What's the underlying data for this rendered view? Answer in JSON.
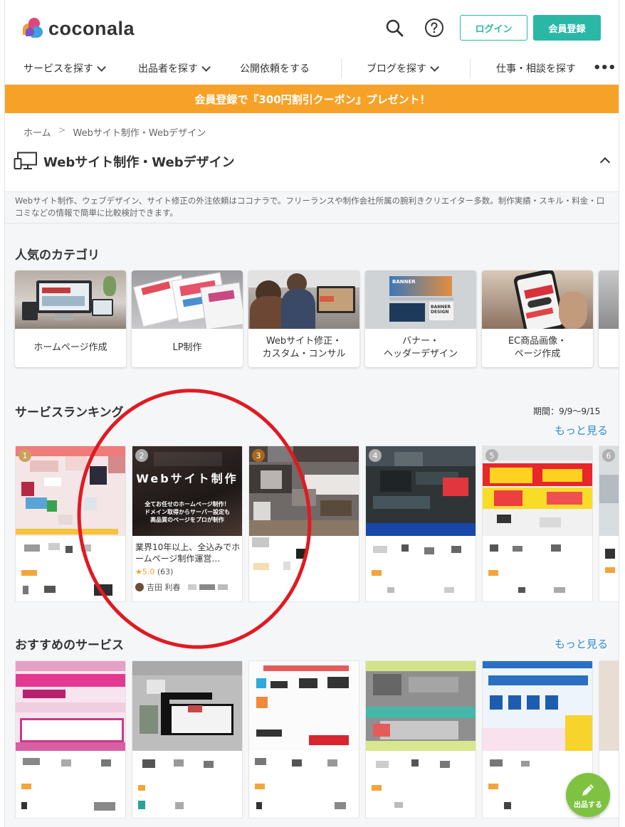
{
  "header": {
    "logo_text": "coconala",
    "login_label": "ログイン",
    "signup_label": "会員登録"
  },
  "nav": {
    "items": [
      {
        "label": "サービスを探す",
        "dropdown": true
      },
      {
        "label": "出品者を探す",
        "dropdown": true
      },
      {
        "label": "公開依頼をする",
        "dropdown": false
      },
      {
        "label": "ブログを探す",
        "dropdown": true
      },
      {
        "label": "仕事・相談を探す",
        "dropdown": false
      }
    ],
    "more": "•••"
  },
  "promo": {
    "text": "会員登録で『300円割引クーポン』プレゼント！"
  },
  "breadcrumb": {
    "home": "ホーム",
    "separator": ">",
    "current": "Webサイト制作・Webデザイン"
  },
  "category": {
    "title": "Webサイト制作・Webデザイン",
    "description": "Webサイト制作、ウェブデザイン、サイト修正の外注依頼はココナラで。フリーランスや制作会社所属の腕利きクリエイター多数。制作実績・スキル・料金・口コミなどの情報で簡単に比較検討できます。"
  },
  "popular": {
    "title": "人気のカテゴリ",
    "items": [
      {
        "label": "ホームページ作成"
      },
      {
        "label": "LP制作"
      },
      {
        "label": "Webサイト修正・\nカスタム・コンサル"
      },
      {
        "label": "バナー・\nヘッダーデザイン"
      },
      {
        "label": "EC商品画像・\nページ作成"
      }
    ],
    "banner_img_text_1": "BANNER",
    "banner_img_text_2": "BANNER\nDESIGN"
  },
  "ranking": {
    "title": "サービスランキング",
    "period": "期間：9/9〜9/15",
    "more": "もっと見る",
    "ranks": [
      "1",
      "2",
      "3",
      "4",
      "5",
      "6"
    ],
    "featured": {
      "image_title": "Webサイト制作",
      "image_sub": "全てお任せのホームページ制作！\nドメイン取得からサーバー設定も\n高品質のページをプロが制作",
      "title": "業界10年以上、全込みでホームページ制作運営…",
      "rating": "5.0",
      "reviews": "(63)",
      "seller": "吉田 利春"
    }
  },
  "recommended": {
    "title": "おすすめのサービス",
    "more": "もっと見る"
  },
  "fab": {
    "label": "出品する"
  },
  "colors": {
    "accent": "#2bb7a6",
    "promo": "#f6a229",
    "link": "#2f8fc8",
    "annotation": "#e01a22",
    "fab": "#7fc241"
  }
}
